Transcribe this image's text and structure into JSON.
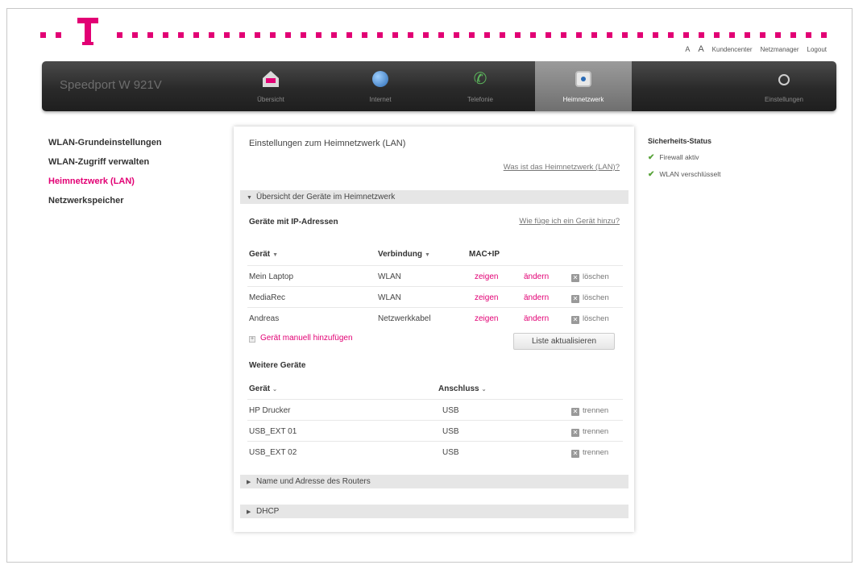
{
  "header": {
    "logo_letter": "T",
    "toplinks": [
      "A",
      "A",
      "Kundencenter",
      "Netzmanager",
      "Logout"
    ]
  },
  "nav": {
    "brand": "Speedport W 921V",
    "tabs": [
      {
        "label": "Übersicht",
        "icon": "home-icon"
      },
      {
        "label": "Internet",
        "icon": "globe-icon"
      },
      {
        "label": "Telefonie",
        "icon": "phone-icon"
      },
      {
        "label": "Heimnetzwerk",
        "icon": "network-icon",
        "active": true
      },
      {
        "label": "Einstellungen",
        "icon": "gear-icon"
      }
    ]
  },
  "sidebar": {
    "items": [
      {
        "label": "WLAN-Grundeinstellungen"
      },
      {
        "label": "WLAN-Zugriff verwalten"
      },
      {
        "label": "Heimnetzwerk (LAN)",
        "active": true
      },
      {
        "label": "Netzwerkspeicher"
      }
    ]
  },
  "main": {
    "title": "Einstellungen zum Heimnetzwerk (LAN)",
    "help_link": "Was ist das Heimnetzwerk (LAN)?",
    "section1": "Übersicht der Geräte im Heimnetzwerk",
    "ip_devices": {
      "heading": "Geräte mit IP-Adressen",
      "help_link": "Wie füge ich ein Gerät hinzu?",
      "col_device": "Gerät",
      "col_connection": "Verbindung",
      "col_macip": "MAC+IP",
      "rows": [
        {
          "device": "Mein Laptop",
          "connection": "WLAN",
          "show": "zeigen",
          "change": "ändern",
          "delete": "löschen"
        },
        {
          "device": "MediaRec",
          "connection": "WLAN",
          "show": "zeigen",
          "change": "ändern",
          "delete": "löschen"
        },
        {
          "device": "Andreas",
          "connection": "Netzwerkkabel",
          "show": "zeigen",
          "change": "ändern",
          "delete": "löschen"
        }
      ],
      "add_manual": "Gerät manuell hinzufügen",
      "refresh_button": "Liste aktualisieren"
    },
    "other_devices": {
      "heading": "Weitere Geräte",
      "col_device": "Gerät",
      "col_port": "Anschluss",
      "rows": [
        {
          "device": "HP Drucker",
          "port": "USB",
          "action": "trennen"
        },
        {
          "device": "USB_EXT 01",
          "port": "USB",
          "action": "trennen"
        },
        {
          "device": "USB_EXT 02",
          "port": "USB",
          "action": "trennen"
        }
      ]
    },
    "section2": "Name und Adresse des Routers",
    "section3": "DHCP"
  },
  "status": {
    "heading": "Sicherheits-Status",
    "items": [
      "Firewall aktiv",
      "WLAN verschlüsselt"
    ]
  },
  "colors": {
    "magenta": "#e20074",
    "ok_green": "#58a33a"
  }
}
